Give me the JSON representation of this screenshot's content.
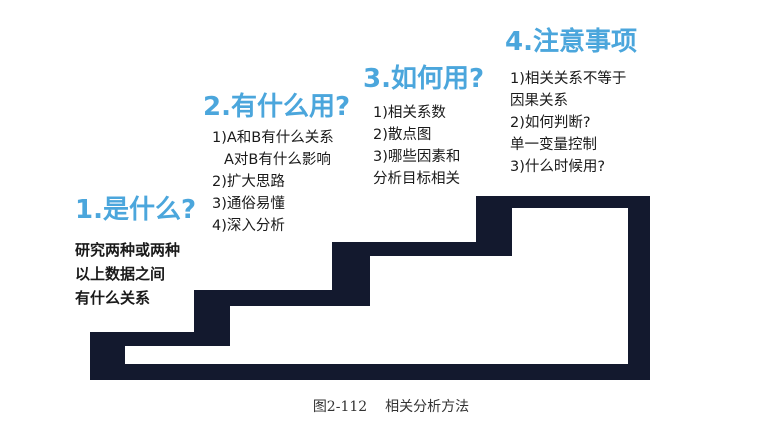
{
  "colors": {
    "title": "#4ba6dc",
    "stair": "#13192e",
    "text": "#1a1a1a"
  },
  "steps": [
    {
      "title": "1.是什么?",
      "lines": [
        "研究两种或两种",
        "以上数据之间",
        "有什么关系"
      ]
    },
    {
      "title": "2.有什么用?",
      "lines": [
        "1)A和B有什么关系",
        "A对B有什么影响",
        "2)扩大思路",
        "3)通俗易懂",
        "4)深入分析"
      ]
    },
    {
      "title": "3.如何用?",
      "lines": [
        "1)相关系数",
        "2)散点图",
        "3)哪些因素和",
        "分析目标相关"
      ]
    },
    {
      "title": "4.注意事项",
      "lines": [
        "1)相关关系不等于",
        "因果关系",
        "2)如何判断?",
        "单一变量控制",
        "3)什么时候用?"
      ]
    }
  ],
  "caption": {
    "number": "图2-112",
    "title": "相关分析方法"
  }
}
